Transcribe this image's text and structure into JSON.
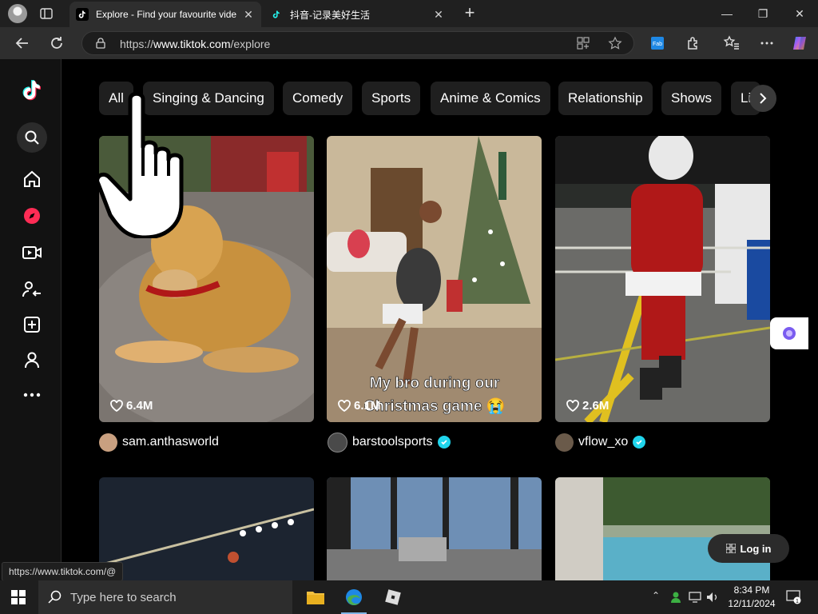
{
  "browser": {
    "tabs": [
      {
        "title": "Explore - Find your favourite vide",
        "active": true
      },
      {
        "title": "抖音-记录美好生活",
        "active": false
      }
    ],
    "url_prefix": "https://",
    "url_domain": "www.tiktok.com",
    "url_path": "/explore",
    "status_url": "https://www.tiktok.com/@"
  },
  "sidebar": {
    "icons": [
      "tiktok-logo-icon",
      "search-icon",
      "home-icon",
      "explore-icon",
      "live-icon",
      "following-icon",
      "upload-icon",
      "profile-icon",
      "more-icon"
    ]
  },
  "categories": [
    "All",
    "Singing & Dancing",
    "Comedy",
    "Sports",
    "Anime & Comics",
    "Relationship",
    "Shows",
    "Li"
  ],
  "videos": [
    {
      "likes": "6.4M",
      "author": "sam.anthasworld",
      "verified": false,
      "caption": ""
    },
    {
      "likes": "6.1M",
      "author": "barstoolsports",
      "verified": true,
      "caption_line1": "My bro during our",
      "caption_line2": "Christmas game 😭"
    },
    {
      "likes": "2.6M",
      "author": "vflow_xo",
      "verified": true,
      "caption": ""
    }
  ],
  "login_label": "Log in",
  "taskbar": {
    "search_placeholder": "Type here to search",
    "time": "8:34 PM",
    "date": "12/11/2024"
  },
  "colors": {
    "accent": "#fe2c55",
    "verified": "#20d5ec",
    "page_bg": "#000000"
  }
}
